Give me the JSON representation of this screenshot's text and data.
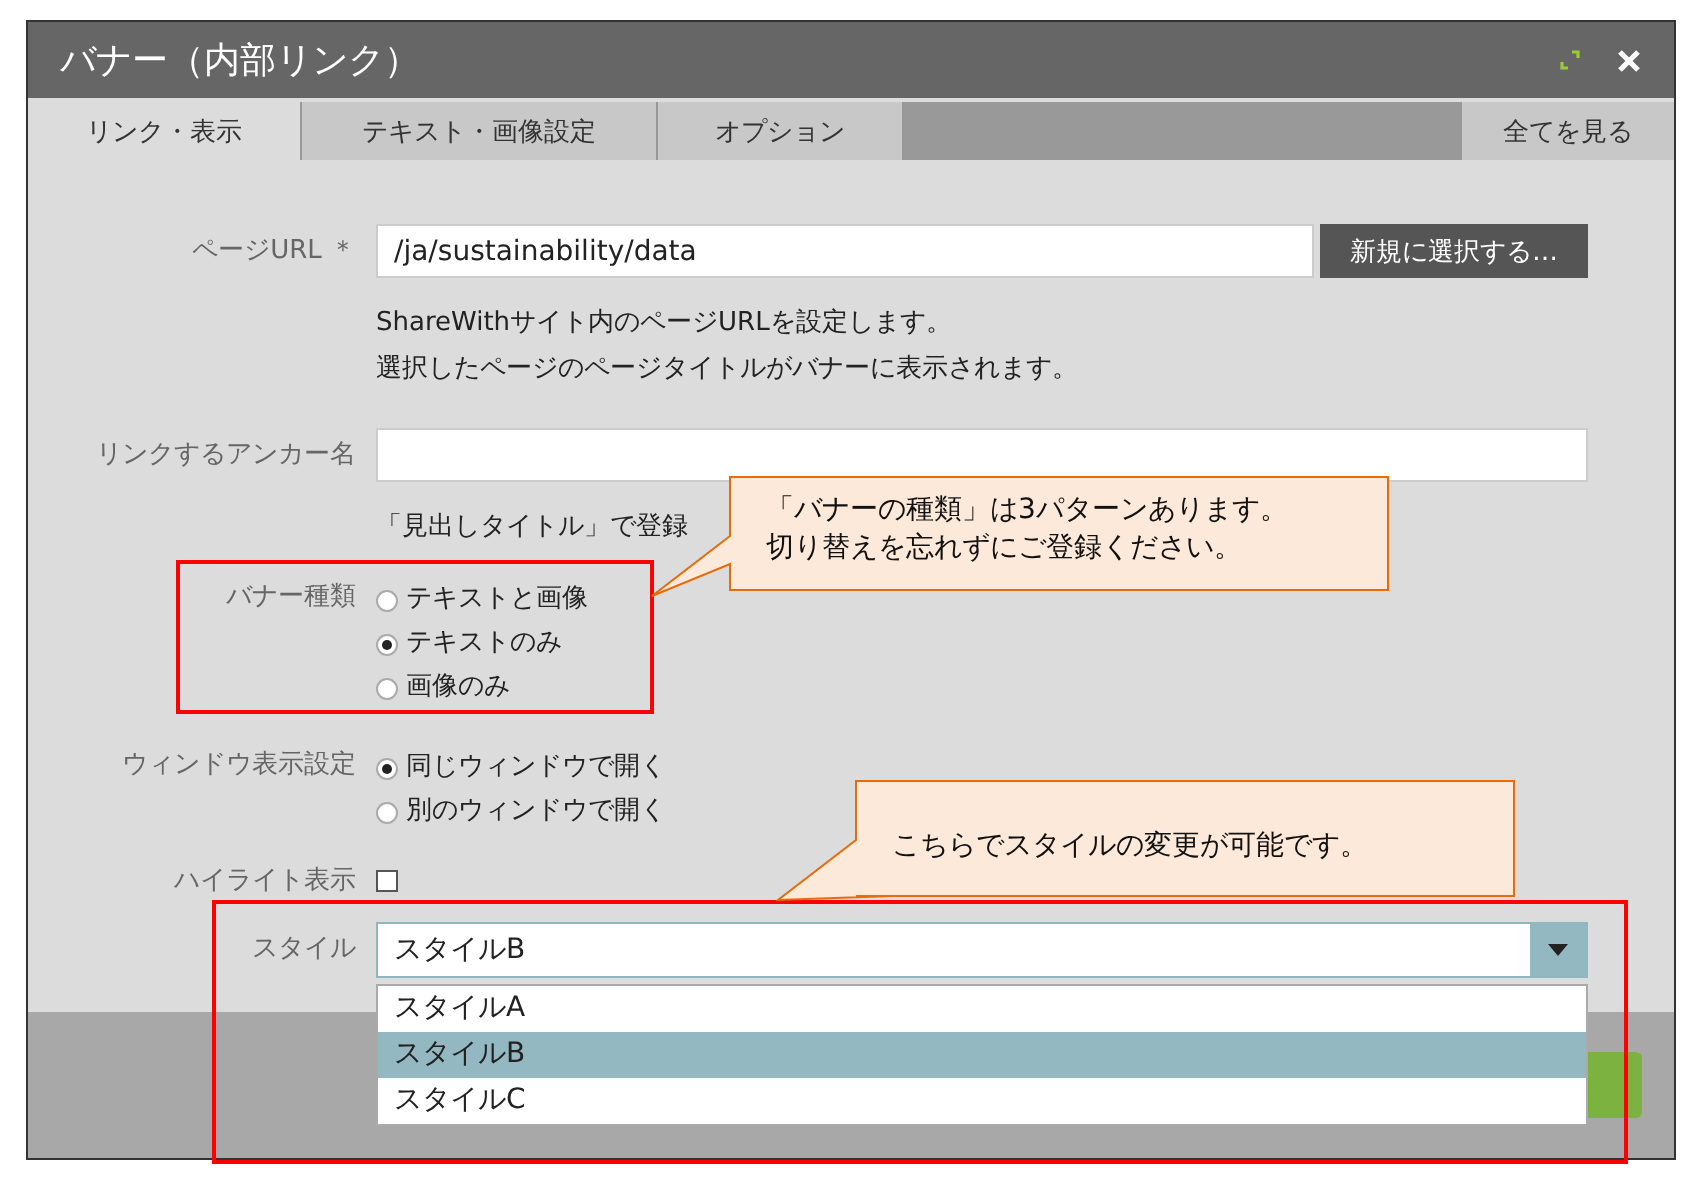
{
  "window": {
    "title": "バナー（内部リンク）"
  },
  "tabs": [
    {
      "label": "リンク・表示",
      "selected": true
    },
    {
      "label": "テキスト・画像設定",
      "selected": false
    },
    {
      "label": "オプション",
      "selected": false
    }
  ],
  "view_all": "全てを見る",
  "page_url": {
    "label": "ページURL ＊",
    "value": "/ja/sustainability/data",
    "button": "新規に選択する…",
    "help": [
      "ShareWithサイト内のページURLを設定します。",
      "選択したページのページタイトルがバナーに表示されます。"
    ]
  },
  "anchor": {
    "label": "リンクするアンカー名",
    "note": "「見出しタイトル」で登録"
  },
  "banner_type": {
    "label": "バナー種類",
    "options": [
      {
        "label": "テキストと画像",
        "selected": false
      },
      {
        "label": "テキストのみ",
        "selected": true
      },
      {
        "label": "画像のみ",
        "selected": false
      }
    ]
  },
  "window_setting": {
    "label": "ウィンドウ表示設定",
    "options": [
      {
        "label": "同じウィンドウで開く",
        "selected": true
      },
      {
        "label": "別のウィンドウで開く",
        "selected": false
      }
    ]
  },
  "highlight": {
    "label": "ハイライト表示",
    "checked": false
  },
  "style": {
    "label": "スタイル",
    "value": "スタイルB",
    "expanded": true,
    "options": [
      {
        "label": "スタイルA",
        "selected": false
      },
      {
        "label": "スタイルB",
        "selected": true
      },
      {
        "label": "スタイルC",
        "selected": false
      }
    ]
  },
  "annotations": [
    {
      "lines": [
        "「バナーの種類」は3パターンあります。",
        "切り替えを忘れずにご登録ください。"
      ]
    },
    {
      "lines": [
        "こちらでスタイルの変更が可能です。"
      ]
    }
  ]
}
